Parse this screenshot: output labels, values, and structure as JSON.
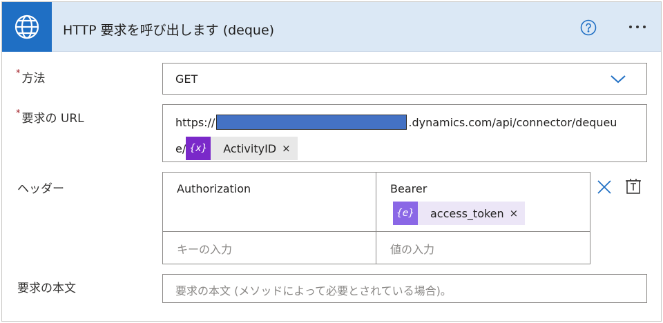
{
  "action": {
    "title": "HTTP 要求を呼び出します (deque)",
    "icon": "globe-icon",
    "help_icon": "help-circle-icon",
    "more_icon": "ellipsis-icon",
    "accent_color": "#1f6fc4",
    "header_bg": "#dbe8f5"
  },
  "method": {
    "required_mark": "*",
    "label": "方法",
    "value": "GET"
  },
  "url": {
    "required_mark": "*",
    "label": "要求の URL",
    "prefix": "https://",
    "suffix": ".dynamics.com/api/connector/dequeu",
    "line2_text": "e/",
    "token": {
      "icon_text": "{x}",
      "label": "ActivityID",
      "remove": "×",
      "color": "#7a29c9"
    }
  },
  "headers": {
    "label": "ヘッダー",
    "rows": [
      {
        "key": "Authorization",
        "value_text": "Bearer",
        "value_token": {
          "icon_text": "{e}",
          "label": "access_token",
          "remove": "×",
          "color": "#8a67e6"
        }
      }
    ],
    "key_placeholder": "キーの入力",
    "value_placeholder": "値の入力"
  },
  "body": {
    "label": "要求の本文",
    "placeholder": "要求の本文 (メソッドによって必要とされている場合)。"
  }
}
